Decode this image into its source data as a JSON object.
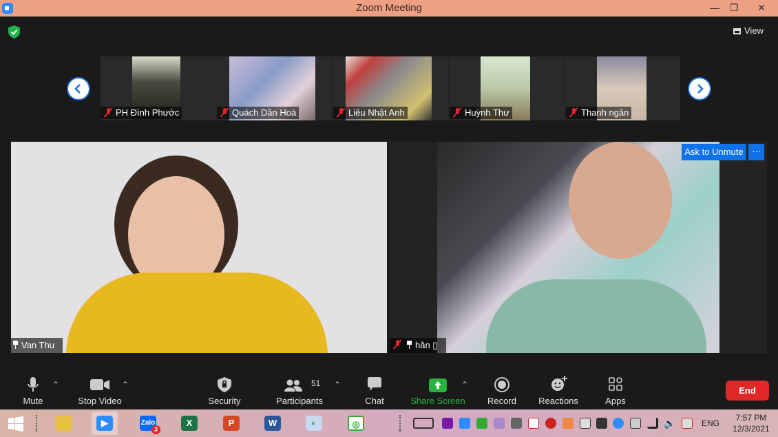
{
  "window": {
    "title": "Zoom Meeting",
    "minimize": "—",
    "restore": "❐",
    "close": "✕"
  },
  "view_button": {
    "label": "View"
  },
  "gallery_strip": [
    {
      "name": "PH Đình Phước"
    },
    {
      "name": "Quách Dần Hoà"
    },
    {
      "name": "Liêu Nhật Anh"
    },
    {
      "name": "Huỳnh Thư"
    },
    {
      "name": "Thanh ngân"
    }
  ],
  "main_tiles": [
    {
      "name": "Van Thu"
    },
    {
      "name": "hân ▯"
    }
  ],
  "ask_to_unmute": "Ask to Unmute",
  "more_dots": "···",
  "toolbar": {
    "mute": "Mute",
    "stop_video": "Stop Video",
    "security": "Security",
    "participants": "Participants",
    "participants_count": "51",
    "chat": "Chat",
    "share_screen": "Share Screen",
    "record": "Record",
    "reactions": "Reactions",
    "apps": "Apps",
    "end": "End"
  },
  "taskbar": {
    "zalo_badge": "3",
    "language": "ENG",
    "time": "7:57 PM",
    "date": "12/3/2021"
  },
  "colors": {
    "accent": "#0e72ed",
    "end": "#e02828",
    "share": "#26b33e",
    "titlebar": "#eea083"
  }
}
